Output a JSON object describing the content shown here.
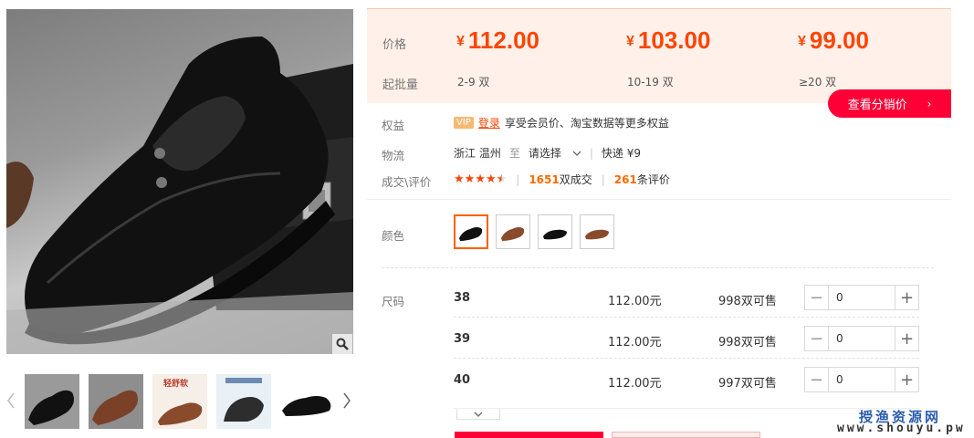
{
  "gallery": {
    "thumbnails": [
      {
        "name": "thumb-black-shoe"
      },
      {
        "name": "thumb-brown-shoe"
      },
      {
        "name": "thumb-promo-shoe",
        "overlay_text": "轻舒软"
      },
      {
        "name": "thumb-sole-detail"
      },
      {
        "name": "thumb-black-shoe-side"
      }
    ]
  },
  "price_panel": {
    "price_label": "价格",
    "moq_label": "起批量",
    "currency": "¥",
    "tiers": [
      {
        "price": "112.00",
        "range": "2-9 双"
      },
      {
        "price": "103.00",
        "range": "10-19 双"
      },
      {
        "price": "99.00",
        "range": "≥20 双"
      }
    ],
    "distribution_button": "查看分销价",
    "distribution_arrow": "›"
  },
  "benefits": {
    "label": "权益",
    "vip": "VIP",
    "login": "登录",
    "text": "享受会员价、淘宝数据等更多权益"
  },
  "logistics": {
    "label": "物流",
    "from": "浙江 温州",
    "to_word": "至",
    "to_select": "请选择",
    "express": "快递 ¥9"
  },
  "rating": {
    "label": "成交\\评价",
    "stars_value": 4.5,
    "deals_count": "1651",
    "deals_unit": "双成交",
    "reviews_count": "261",
    "reviews_unit": "条评价"
  },
  "color": {
    "label": "颜色",
    "selected_index": 0
  },
  "size": {
    "label": "尺码",
    "rows": [
      {
        "size": "38",
        "price": "112.00元",
        "stock": "998双可售",
        "qty": "0"
      },
      {
        "size": "39",
        "price": "112.00元",
        "stock": "998双可售",
        "qty": "0"
      },
      {
        "size": "40",
        "price": "112.00元",
        "stock": "997双可售",
        "qty": "0"
      }
    ]
  },
  "watermark": {
    "line1": "授渔资源网",
    "line2": "www.shouyu.pw"
  },
  "colors": {
    "accent": "#ff4400",
    "button_red": "#ff0036",
    "price_bg": "#fff1e9"
  }
}
